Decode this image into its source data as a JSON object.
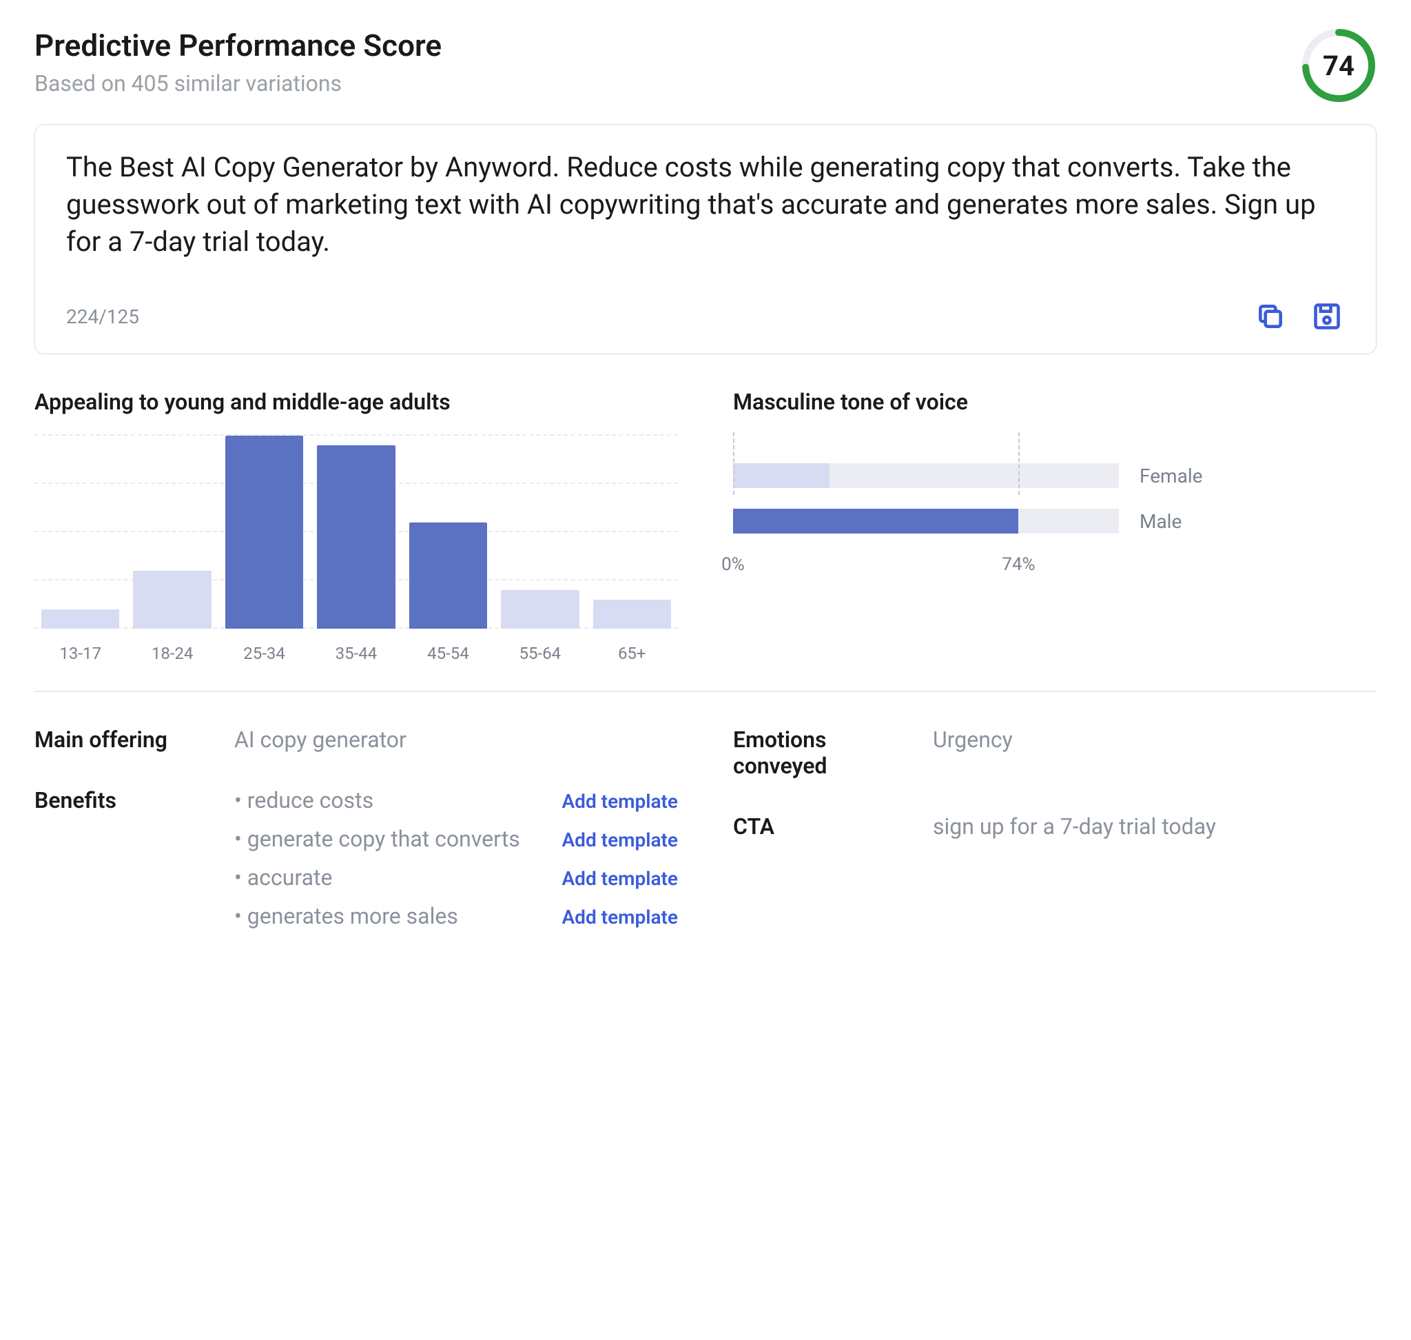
{
  "header": {
    "title": "Predictive Performance Score",
    "subtitle": "Based on 405 similar variations",
    "score": 74
  },
  "copy": {
    "text": "The Best AI Copy Generator by Anyword. Reduce costs while generating copy that converts. Take the guesswork out of marketing text with AI copywriting that's accurate and generates more sales. Sign up for a 7-day trial today.",
    "counter": "224/125"
  },
  "ageChart": {
    "title": "Appealing to young and middle-age adults"
  },
  "toneChart": {
    "title": "Masculine tone of voice",
    "axisMin": "0%",
    "axisMax": "74%",
    "rows": [
      {
        "label": "Female",
        "value": 25,
        "color": "#d7dcf2"
      },
      {
        "label": "Male",
        "value": 74,
        "color": "#5b72c2"
      }
    ]
  },
  "info": {
    "mainOfferingLabel": "Main offering",
    "mainOffering": "AI copy generator",
    "benefitsLabel": "Benefits",
    "benefits": [
      "reduce costs",
      "generate copy that converts",
      "accurate",
      "generates more sales"
    ],
    "addTemplateLabel": "Add template",
    "emotionsLabel": "Emotions conveyed",
    "emotions": "Urgency",
    "ctaLabel": "CTA",
    "cta": "sign up for a 7-day trial today"
  },
  "chart_data": [
    {
      "type": "bar",
      "title": "Appealing to young and middle-age adults",
      "categories": [
        "13-17",
        "18-24",
        "25-34",
        "35-44",
        "45-54",
        "55-64",
        "65+"
      ],
      "values": [
        10,
        30,
        100,
        95,
        55,
        20,
        15
      ],
      "highlighted": [
        false,
        false,
        true,
        true,
        true,
        false,
        false
      ],
      "ylim": [
        0,
        100
      ]
    },
    {
      "type": "bar",
      "title": "Masculine tone of voice",
      "orientation": "horizontal",
      "categories": [
        "Female",
        "Male"
      ],
      "values": [
        25,
        74
      ],
      "xlabel": "%",
      "xlim": [
        0,
        100
      ]
    }
  ],
  "colors": {
    "barLight": "#d7dcf2",
    "barDark": "#5b72c2",
    "ringTrack": "#ececf2",
    "ringFill": "#2e9e3f"
  }
}
